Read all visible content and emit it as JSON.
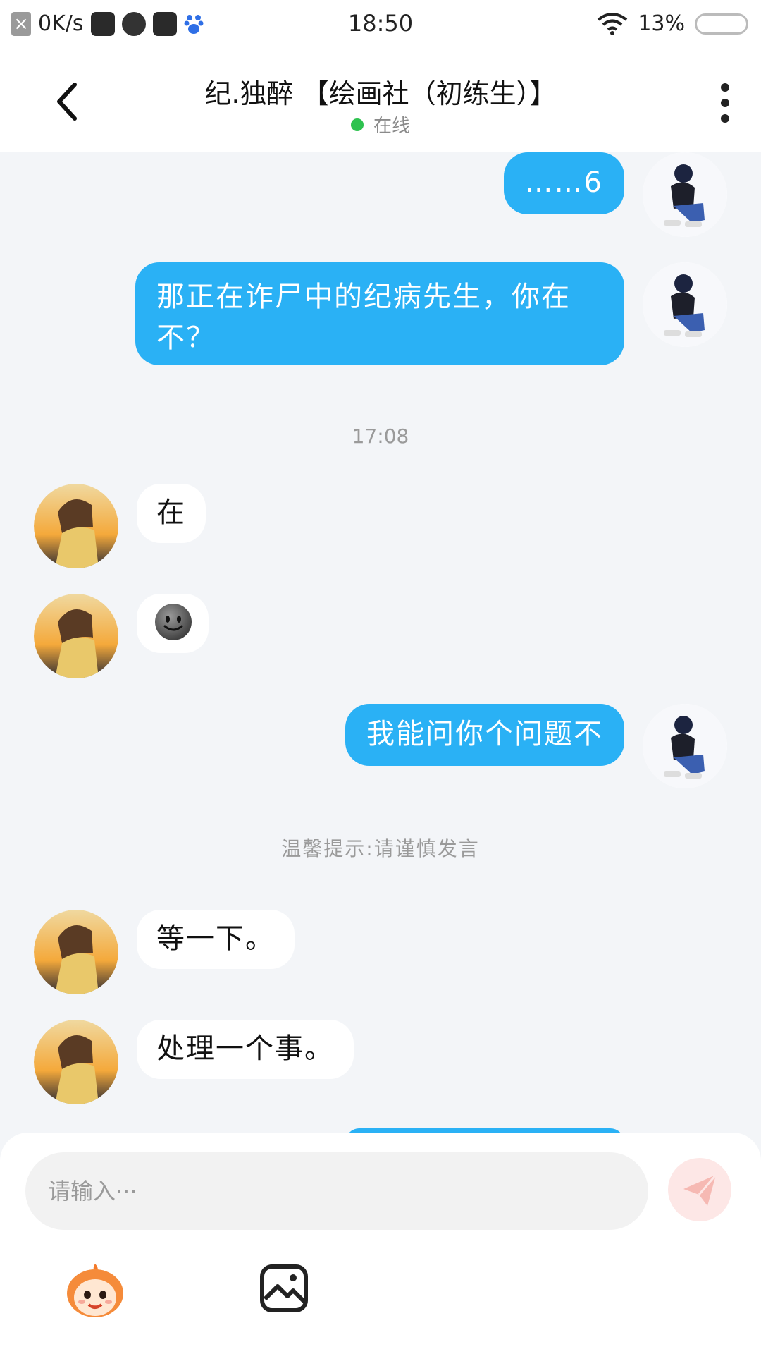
{
  "status_bar": {
    "net_speed": "0K/s",
    "time": "18:50",
    "battery": "13%"
  },
  "header": {
    "title": "纪.独醉 【绘画社（初练生）】",
    "status": "在线"
  },
  "messages": [
    {
      "from": "me",
      "text": "……6"
    },
    {
      "from": "me",
      "text": "那正在诈尸中的纪病先生，你在不？"
    },
    {
      "type": "time",
      "text": "17:08"
    },
    {
      "from": "them",
      "text": "在"
    },
    {
      "from": "them",
      "emoji": "smile-emoji"
    },
    {
      "from": "me",
      "text": "我能问你个问题不"
    },
    {
      "type": "tip",
      "text": "温馨提示:请谨慎发言"
    },
    {
      "from": "them",
      "text": "等一下。"
    },
    {
      "from": "them",
      "text": "处理一个事。"
    }
  ],
  "input": {
    "placeholder": "请输入···"
  },
  "icons": {
    "back": "back-icon",
    "menu": "more-vertical-icon",
    "send": "send-icon",
    "mascot": "mascot-sticker-icon",
    "image": "image-icon"
  },
  "colors": {
    "accent": "#2ab1f5",
    "online": "#2ec24f"
  }
}
